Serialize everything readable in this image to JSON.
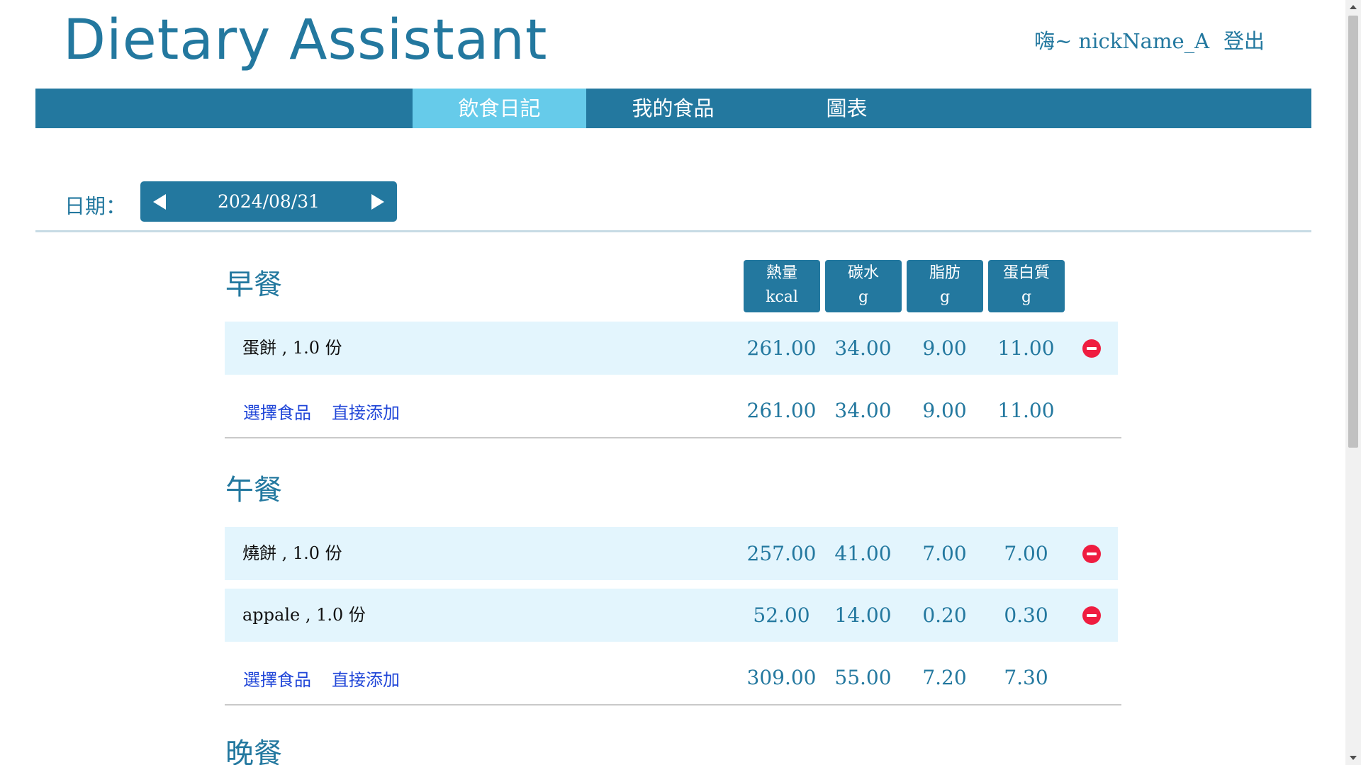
{
  "header": {
    "logo": "Dietary Assistant",
    "greeting": "嗨~ nickName_A",
    "logout": "登出"
  },
  "nav": {
    "tabs": [
      {
        "label": "飲食日記",
        "active": true
      },
      {
        "label": "我的食品",
        "active": false
      },
      {
        "label": "圖表",
        "active": false
      }
    ]
  },
  "date": {
    "label": "日期：",
    "value": "2024/08/31",
    "prev_icon": "triangle-left-icon",
    "next_icon": "triangle-right-icon"
  },
  "columns": [
    {
      "name": "熱量",
      "unit": "kcal"
    },
    {
      "name": "碳水",
      "unit": "g"
    },
    {
      "name": "脂肪",
      "unit": "g"
    },
    {
      "name": "蛋白質",
      "unit": "g"
    }
  ],
  "meals": {
    "breakfast": {
      "title": "早餐",
      "items": [
        {
          "name": "蛋餅 , 1.0 份",
          "values": [
            "261.00",
            "34.00",
            "9.00",
            "11.00"
          ]
        }
      ],
      "select_food": "選擇食品",
      "add_direct": "直接添加",
      "totals": [
        "261.00",
        "34.00",
        "9.00",
        "11.00"
      ]
    },
    "lunch": {
      "title": "午餐",
      "items": [
        {
          "name": "燒餅 , 1.0 份",
          "values": [
            "257.00",
            "41.00",
            "7.00",
            "7.00"
          ]
        },
        {
          "name": "appale , 1.0 份",
          "values": [
            "52.00",
            "14.00",
            "0.20",
            "0.30"
          ]
        }
      ],
      "select_food": "選擇食品",
      "add_direct": "直接添加",
      "totals": [
        "309.00",
        "55.00",
        "7.20",
        "7.30"
      ]
    },
    "dinner": {
      "title": "晚餐"
    }
  },
  "colors": {
    "primary": "#23789f",
    "active_tab": "#66cbea",
    "row_band": "#e3f5fd",
    "remove": "#ef1d40",
    "link": "#2046d8"
  }
}
